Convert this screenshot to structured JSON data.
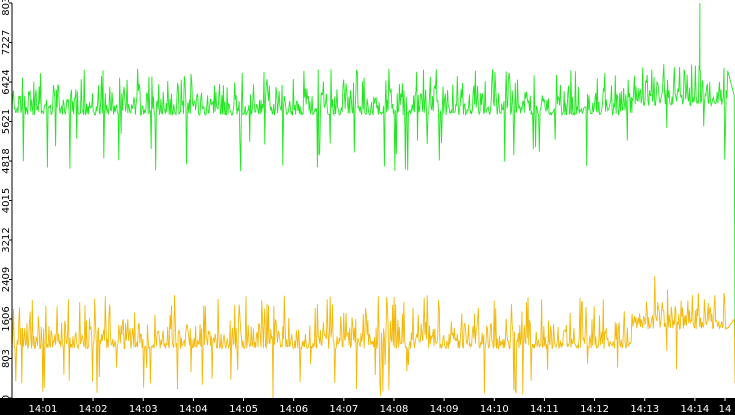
{
  "chart_data": {
    "type": "line",
    "title": "",
    "xlabel": "",
    "ylabel": "",
    "x_range": [
      "14:00:23",
      "14:14:48"
    ],
    "x_ticks": [
      "14:01",
      "14:02",
      "14:03",
      "14:04",
      "14:05",
      "14:06",
      "14:07",
      "14:08",
      "14:09",
      "14:10",
      "14:11",
      "14:12",
      "14:13",
      "14:14",
      "14"
    ],
    "y_ticks": [
      0,
      803,
      1606,
      2409,
      3212,
      4015,
      4818,
      5621,
      6424,
      7227,
      8031
    ],
    "ylim": [
      0,
      8031
    ],
    "grid": false,
    "series": [
      {
        "color": "#22e622",
        "segments": [
          {
            "from": "14:00:23",
            "to": "14:12:45",
            "mean": 5950,
            "low": 5250,
            "high": 6450,
            "min": 4580
          },
          {
            "from": "14:12:45",
            "to": "14:14:40",
            "mean": 6150,
            "low": 5400,
            "high": 6650,
            "min": 4700
          }
        ],
        "peaks": [
          {
            "x": "14:14:06",
            "y": 8031
          }
        ],
        "end_drop": {
          "x": "14:14:48",
          "y": 1200
        }
      },
      {
        "color": "#f2b90c",
        "segments": [
          {
            "from": "14:00:23",
            "to": "14:12:45",
            "mean": 1200,
            "low": 600,
            "high": 1800,
            "min": 0
          },
          {
            "from": "14:12:45",
            "to": "14:14:40",
            "mean": 1600,
            "low": 1000,
            "high": 2200,
            "min": 200
          }
        ],
        "peaks": [],
        "end_drop": {
          "x": "14:14:48",
          "y": 300
        }
      }
    ]
  }
}
